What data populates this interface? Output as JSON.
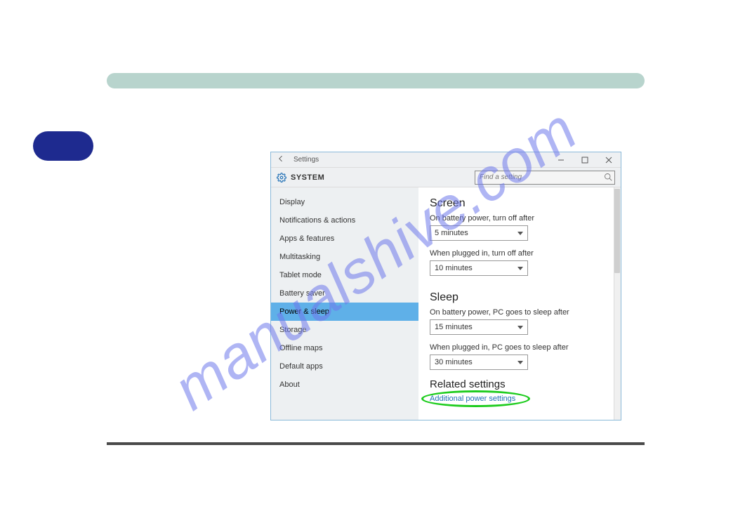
{
  "watermark": "manualshive.com",
  "window": {
    "title": "Settings",
    "system_label": "SYSTEM",
    "search_placeholder": "Find a setting"
  },
  "sidebar": {
    "items": [
      {
        "label": "Display"
      },
      {
        "label": "Notifications & actions"
      },
      {
        "label": "Apps & features"
      },
      {
        "label": "Multitasking"
      },
      {
        "label": "Tablet mode"
      },
      {
        "label": "Battery saver"
      },
      {
        "label": "Power & sleep"
      },
      {
        "label": "Storage"
      },
      {
        "label": "Offline maps"
      },
      {
        "label": "Default apps"
      },
      {
        "label": "About"
      }
    ],
    "active_index": 6
  },
  "main": {
    "screen": {
      "heading": "Screen",
      "battery_label": "On battery power, turn off after",
      "battery_value": "5 minutes",
      "plugged_label": "When plugged in, turn off after",
      "plugged_value": "10 minutes"
    },
    "sleep": {
      "heading": "Sleep",
      "battery_label": "On battery power, PC goes to sleep after",
      "battery_value": "15 minutes",
      "plugged_label": "When plugged in, PC goes to sleep after",
      "plugged_value": "30 minutes"
    },
    "related": {
      "heading": "Related settings",
      "link": "Additional power settings"
    }
  },
  "annotation": {
    "highlight_color": "#1ecc1e"
  }
}
